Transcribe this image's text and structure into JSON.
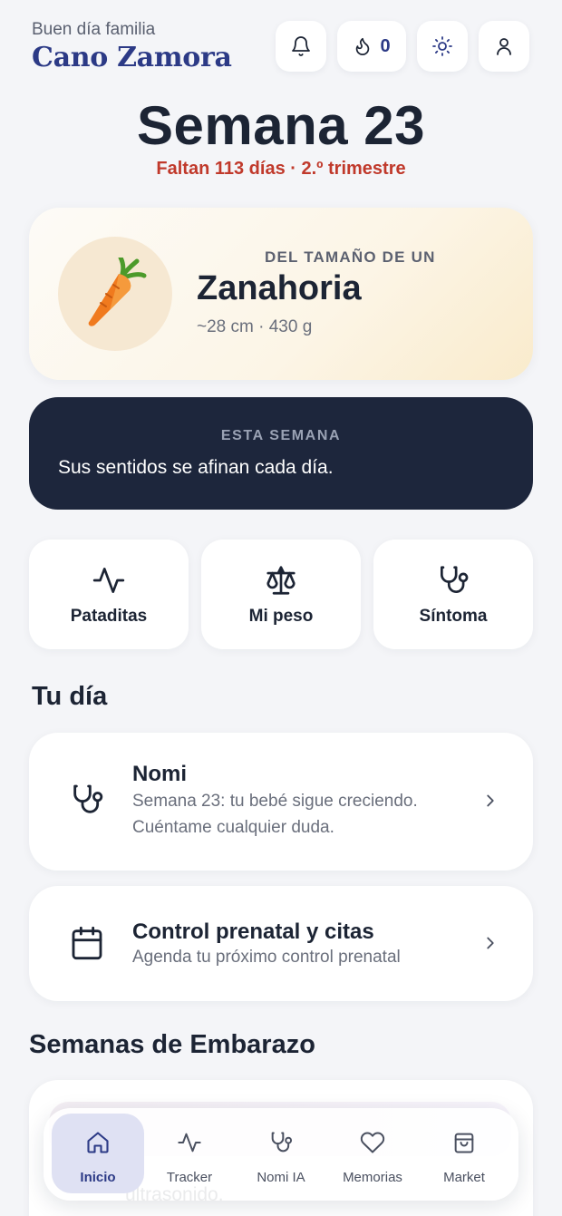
{
  "header": {
    "greeting": "Buen día familia",
    "family_name": "Cano Zamora",
    "streak_count": "0",
    "icons": [
      "bell-icon",
      "flame-icon",
      "sun-icon",
      "user-icon"
    ]
  },
  "week": {
    "title": "Semana 23",
    "subtitle": "Faltan 113 días · 2.º trimestre"
  },
  "size_card": {
    "eyebrow": "DEL TAMAÑO DE UN",
    "name": "Zanahoria",
    "meta": "~28 cm · 430 g",
    "emoji": "carrot"
  },
  "this_week": {
    "eyebrow": "ESTA SEMANA",
    "message": "Sus sentidos se afinan cada día."
  },
  "quick_actions": [
    {
      "label": "Pataditas",
      "icon": "activity-icon"
    },
    {
      "label": "Mi peso",
      "icon": "scale-icon"
    },
    {
      "label": "Síntoma",
      "icon": "stethoscope-icon"
    }
  ],
  "tu_dia": {
    "title": "Tu día",
    "items": [
      {
        "title": "Nomi",
        "desc_line1": "Semana 23: tu bebé sigue creciendo.",
        "desc_line2": "Cuéntame cualquier duda.",
        "icon": "stethoscope-icon"
      },
      {
        "title": "Control prenatal y citas",
        "desc_line1": "Agenda tu próximo control prenatal",
        "icon": "calendar-icon"
      }
    ]
  },
  "weeks_section": {
    "title": "Semanas de Embarazo",
    "peek_text": "ultrasonido."
  },
  "nav": {
    "items": [
      {
        "label": "Inicio",
        "icon": "home-icon",
        "active": true
      },
      {
        "label": "Tracker",
        "icon": "activity-icon",
        "active": false
      },
      {
        "label": "Nomi IA",
        "icon": "stethoscope-icon",
        "active": false
      },
      {
        "label": "Memorias",
        "icon": "heart-icon",
        "active": false
      },
      {
        "label": "Market",
        "icon": "shopping-bag-icon",
        "active": false
      }
    ]
  },
  "colors": {
    "brand": "#2c3a86",
    "alert": "#c0392b",
    "dark_card": "#1d263c",
    "background": "#f4f5f8"
  }
}
